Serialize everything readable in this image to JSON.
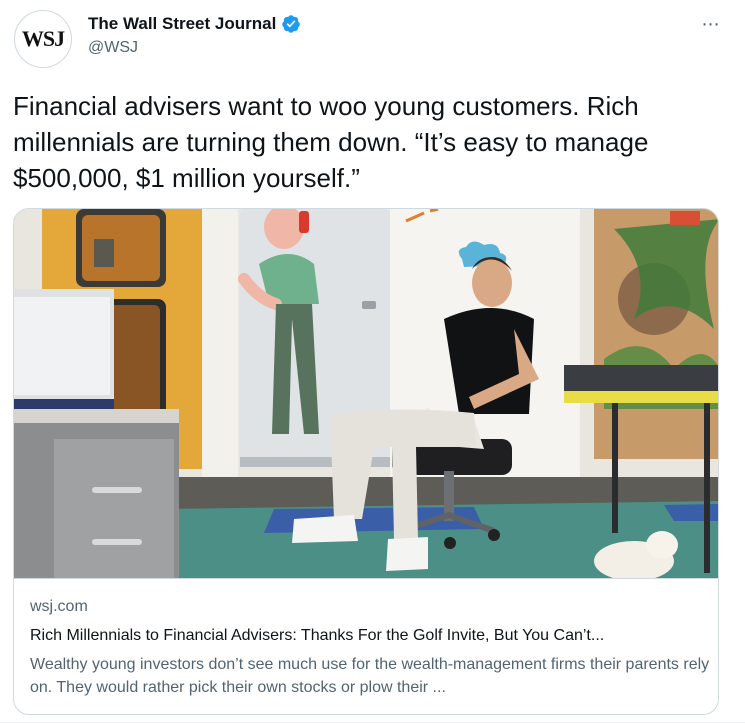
{
  "author": {
    "avatar_text": "WSJ",
    "display_name": "The Wall Street Journal",
    "handle": "@WSJ",
    "verified": true,
    "verified_color": "#1d9bf0"
  },
  "more_icon": "⋯",
  "tweet_text": "Financial advisers want to woo young customers. Rich millennials are turning them down. “It’s easy to manage $500,000, $1 million yourself.”",
  "card": {
    "domain": "wsj.com",
    "title": "Rich Millennials to Financial Advisers: Thanks For the Golf Invite, But You Can’t...",
    "description": "Wealthy young investors don’t see much use for the wealth-management firms their parents rely on. They would rather pick their own stocks or plow their ..."
  },
  "colors": {
    "text_primary": "#0f1419",
    "text_secondary": "#536471",
    "border": "#cfd9de"
  }
}
